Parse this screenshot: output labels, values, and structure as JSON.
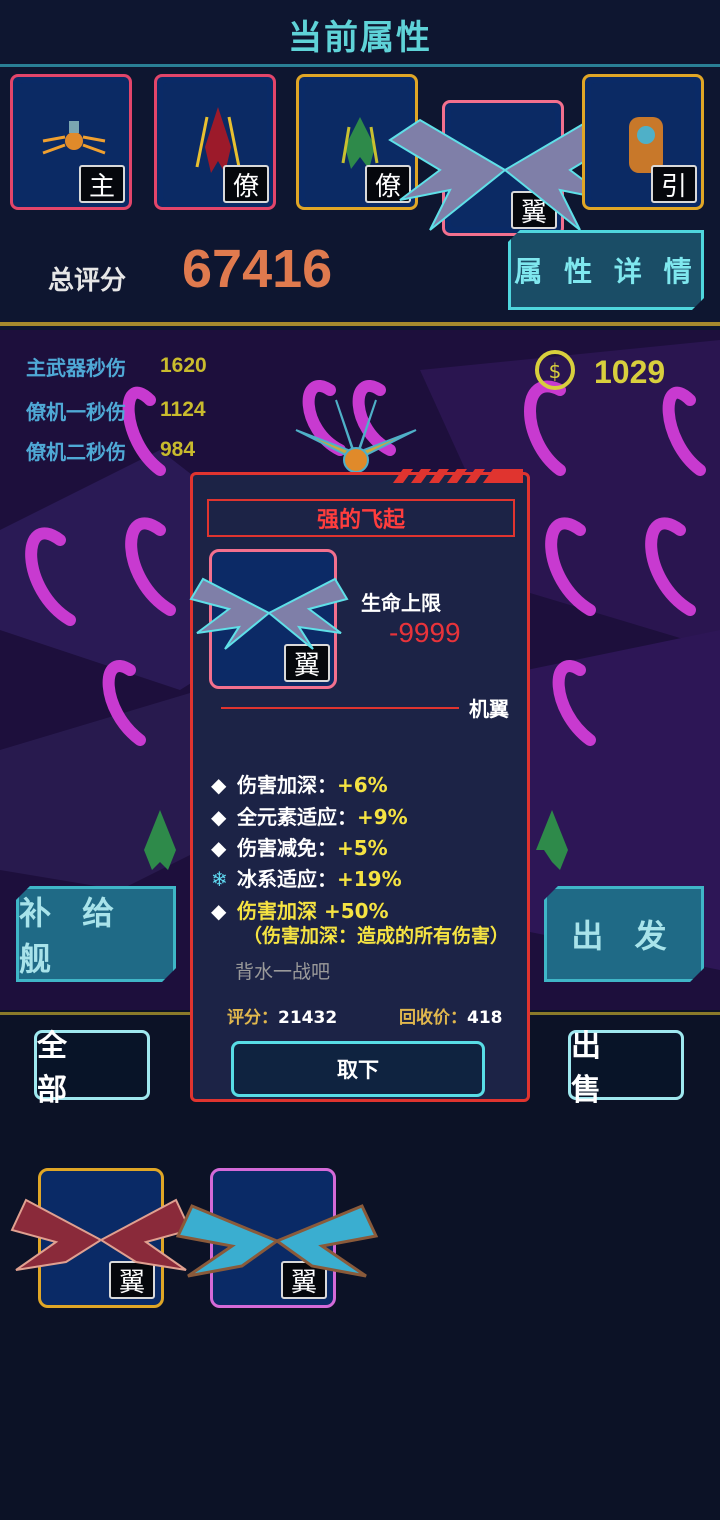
{
  "header": {
    "title": "当前属性",
    "slots": [
      {
        "tag": "主",
        "frame_color": "#e2456a"
      },
      {
        "tag": "僚",
        "frame_color": "#e2456a"
      },
      {
        "tag": "僚",
        "frame_color": "#e0a626"
      },
      {
        "tag": "翼",
        "frame_color": "#f2708e"
      },
      {
        "tag": "引",
        "frame_color": "#e0a626"
      }
    ],
    "score_label": "总评分",
    "score_value": "67416",
    "detail_button": "属 性 详 情"
  },
  "stats": [
    {
      "label": "主武器秒伤",
      "value": "1620"
    },
    {
      "label": "僚机一秒伤",
      "value": "1124"
    },
    {
      "label": "僚机二秒伤",
      "value": "984"
    }
  ],
  "coins": "1029",
  "buttons": {
    "supply": "补 给 舰",
    "depart": "出 发",
    "all": "全 部",
    "sell": "出 售"
  },
  "inventory": [
    {
      "tag": "翼",
      "frame_color": "#e0a626"
    },
    {
      "tag": "翼",
      "frame_color": "#d46ad8"
    }
  ],
  "popup": {
    "title": "强的飞起",
    "item_tag": "翼",
    "attr_label": "生命上限",
    "attr_value": "-9999",
    "type": "机翼",
    "effects": [
      {
        "name": "伤害加深：",
        "value": "+6%"
      },
      {
        "name": "全元素适应：",
        "value": "+9%"
      },
      {
        "name": "伤害减免：",
        "value": "+5%"
      },
      {
        "name": "冰系适应：",
        "value": "+19%"
      }
    ],
    "special_effect": "伤害加深 +50%",
    "special_note": "（伤害加深：造成的所有伤害）",
    "flavor": "背水一战吧",
    "score_label": "评分：",
    "score_value": "21432",
    "recycle_label": "回收价：",
    "recycle_value": "418",
    "remove_button": "取下"
  }
}
